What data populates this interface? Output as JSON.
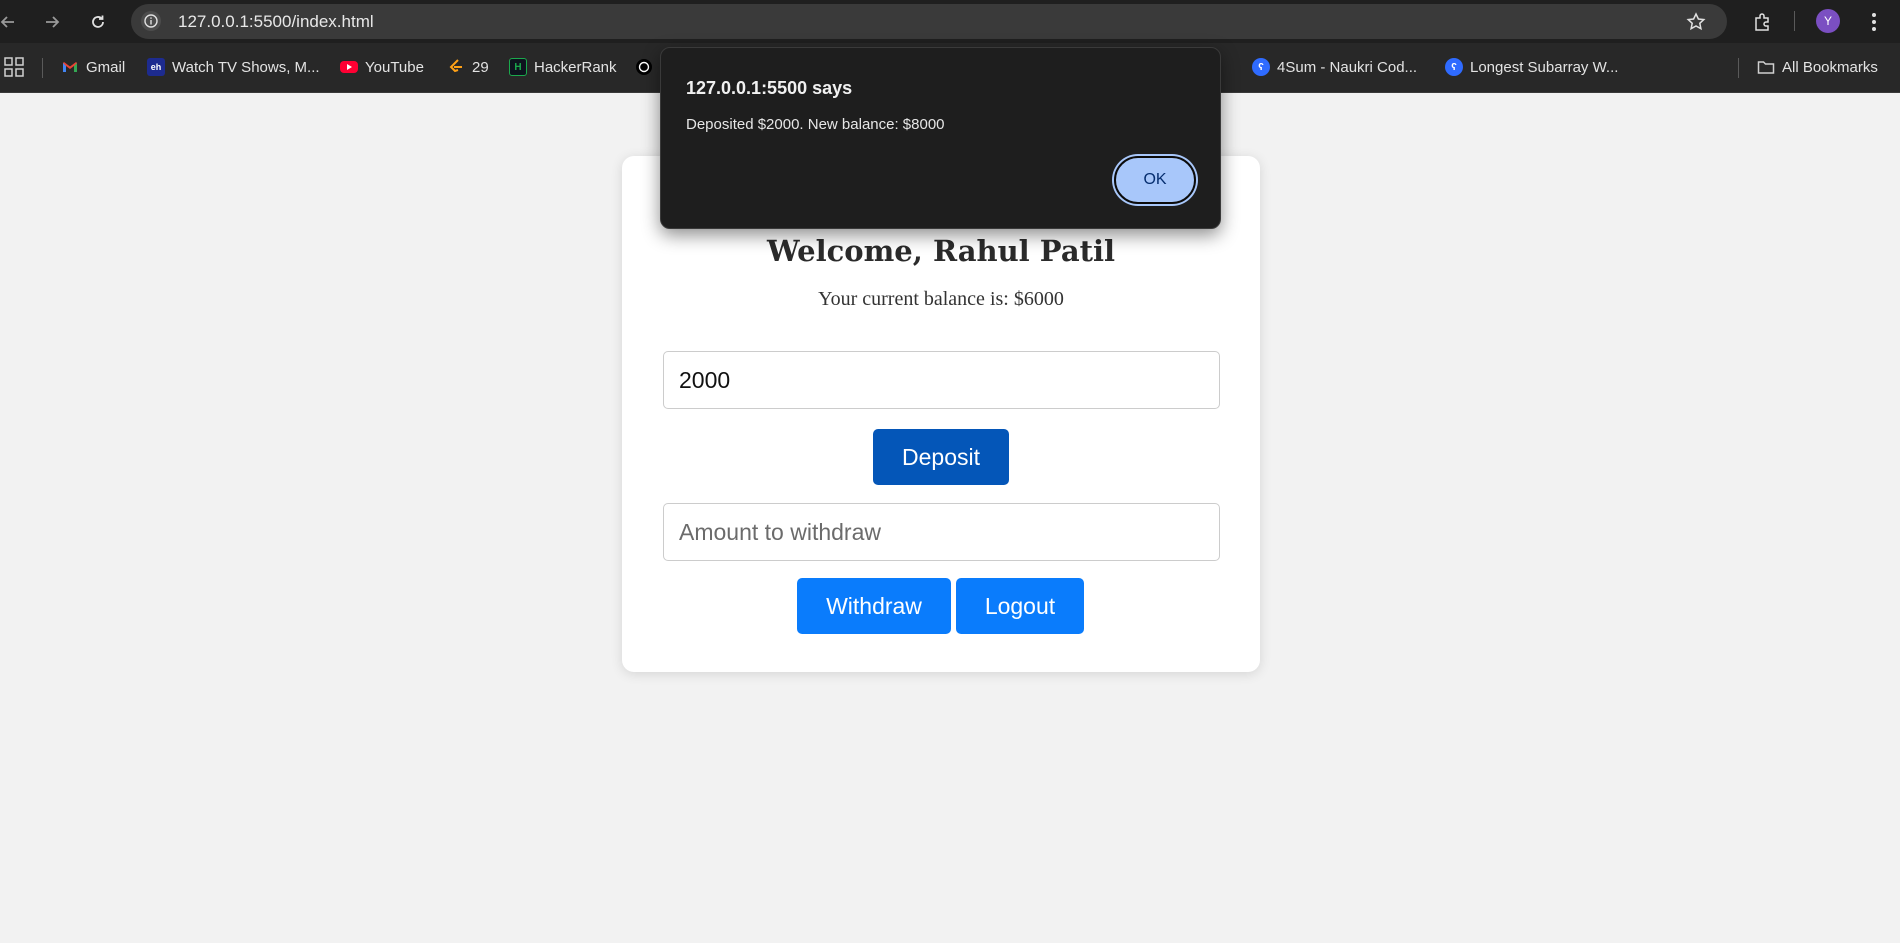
{
  "browser": {
    "url": "127.0.0.1:5500/index.html",
    "bookmarks": [
      {
        "label": "Gmail",
        "icon": "gmail-icon"
      },
      {
        "label": "Watch TV Shows, M...",
        "icon": "tv-shows-icon"
      },
      {
        "label": "YouTube",
        "icon": "youtube-icon"
      },
      {
        "label": "29",
        "icon": "leetcode-icon"
      },
      {
        "label": "HackerRank",
        "icon": "hackerrank-icon"
      },
      {
        "label": "",
        "icon": "chatgpt-icon"
      },
      {
        "label": "4Sum - Naukri Cod...",
        "icon": "naukri-icon"
      },
      {
        "label": "Longest Subarray W...",
        "icon": "naukri-icon"
      }
    ],
    "all_bookmarks": "All Bookmarks",
    "profile_initial": "Y"
  },
  "dialog": {
    "title": "127.0.0.1:5500 says",
    "message": "Deposited $2000. New balance: $8000",
    "ok_label": "OK"
  },
  "page": {
    "welcome": "Welcome, Rahul Patil",
    "balance_text": "Your current balance is: $6000",
    "deposit_value": "2000",
    "deposit_label": "Deposit",
    "withdraw_placeholder": "Amount to withdraw",
    "withdraw_label": "Withdraw",
    "logout_label": "Logout"
  },
  "colors": {
    "deposit_button": "#0456b8",
    "primary_button": "#0a7cfc",
    "dialog_ok": "#a8c7fa",
    "dialog_bg": "#1e1e1e"
  }
}
